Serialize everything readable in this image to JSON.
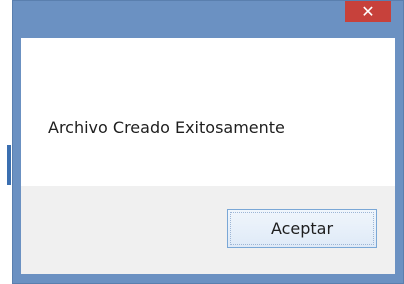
{
  "titlebar": {
    "close_glyph": "✕",
    "close_icon": "close-icon",
    "close_color": "#c7413b",
    "frame_color": "#6b91c2"
  },
  "message": {
    "text": "Archivo Creado Exitosamente"
  },
  "buttons": {
    "accept_label": "Aceptar"
  }
}
